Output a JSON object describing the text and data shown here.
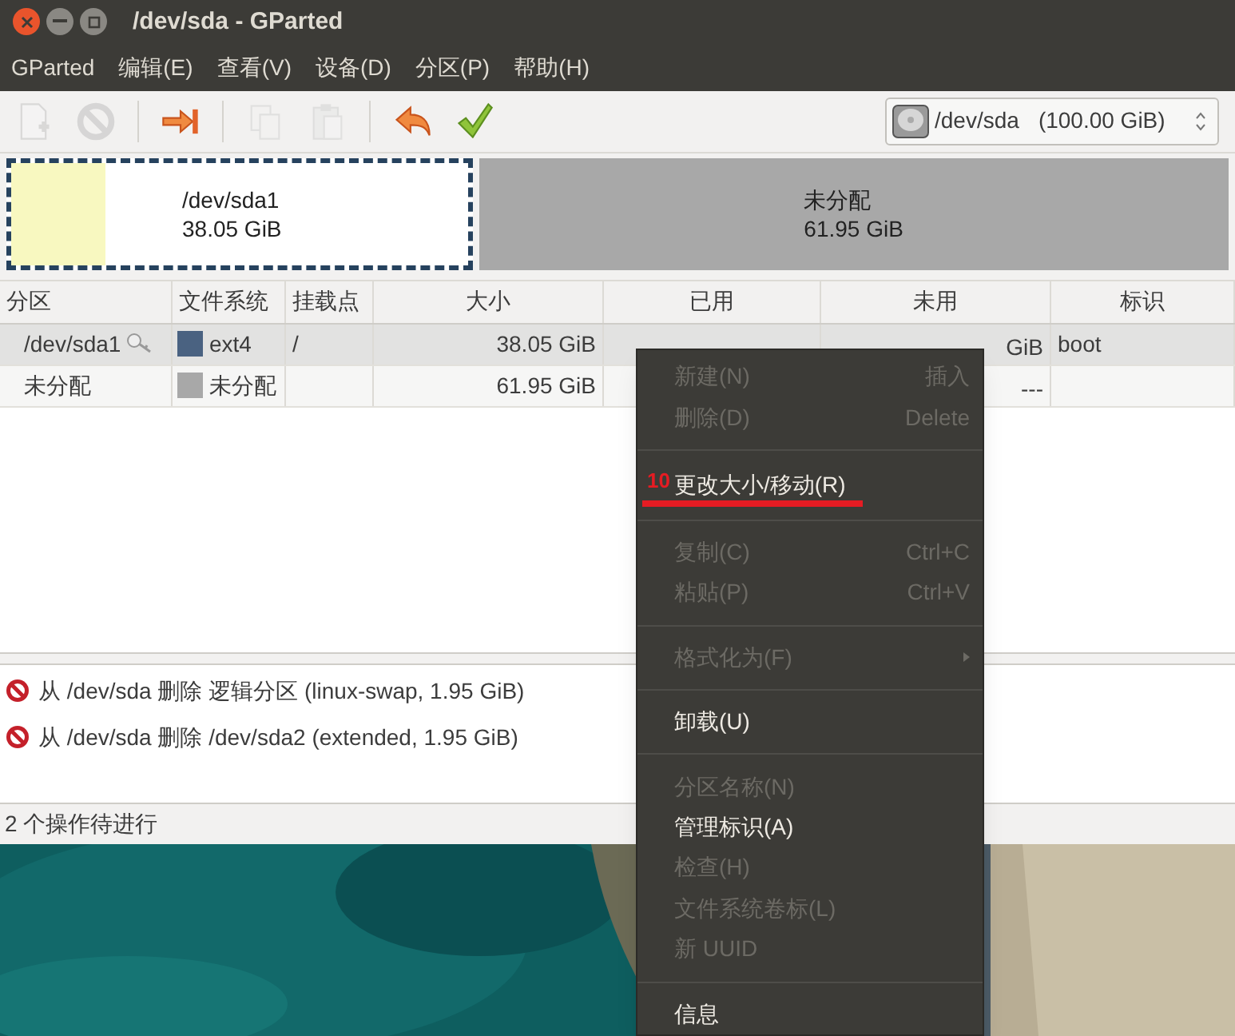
{
  "window": {
    "title": "/dev/sda - GParted"
  },
  "menubar": [
    "GParted",
    "编辑(E)",
    "查看(V)",
    "设备(D)",
    "分区(P)",
    "帮助(H)"
  ],
  "toolbar": [
    {
      "kind": "new",
      "disabled": true
    },
    {
      "kind": "delete",
      "disabled": true
    },
    {
      "kind": "separator"
    },
    {
      "kind": "resize",
      "disabled": false
    },
    {
      "kind": "separator"
    },
    {
      "kind": "copy",
      "disabled": true
    },
    {
      "kind": "paste",
      "disabled": true
    },
    {
      "kind": "separator"
    },
    {
      "kind": "undo",
      "disabled": false
    },
    {
      "kind": "apply",
      "disabled": false
    }
  ],
  "device_selector": {
    "name": "/dev/sda",
    "size": "(100.00 GiB)"
  },
  "disk_map": [
    {
      "name": "/dev/sda1",
      "size": "38.05 GiB",
      "kind": "partition",
      "selected": true
    },
    {
      "name": "未分配",
      "size": "61.95 GiB",
      "kind": "unallocated",
      "selected": false
    }
  ],
  "table": {
    "columns": [
      "分区",
      "文件系统",
      "挂载点",
      "大小",
      "已用",
      "未用",
      "标识"
    ],
    "rows": [
      {
        "partition": "/dev/sda1",
        "locked": true,
        "filesystem": "ext4",
        "color": "#4a6281",
        "mount": "/",
        "size": "38.05 GiB",
        "unused": "GiB",
        "flags": "boot",
        "selected": true
      },
      {
        "partition": "未分配",
        "locked": false,
        "filesystem": "未分配",
        "color": "#a8a8a8",
        "size": "61.95 GiB",
        "unused": "---",
        "selected": false
      }
    ]
  },
  "operations": [
    "从 /dev/sda 删除 逻辑分区 (linux-swap, 1.95 GiB)",
    "从 /dev/sda 删除 /dev/sda2 (extended, 1.95 GiB)"
  ],
  "status_bar": "2 个操作待进行",
  "context_menu": [
    {
      "kind": "item",
      "label": "新建(N)",
      "shortcut": "插入",
      "disabled": true
    },
    {
      "kind": "item",
      "label": "删除(D)",
      "shortcut": "Delete",
      "disabled": true
    },
    {
      "kind": "separator"
    },
    {
      "kind": "item",
      "label": "更改大小/移动(R)",
      "disabled": false,
      "annotation": "10"
    },
    {
      "kind": "separator"
    },
    {
      "kind": "item",
      "label": "复制(C)",
      "shortcut": "Ctrl+C",
      "disabled": true
    },
    {
      "kind": "item",
      "label": "粘贴(P)",
      "shortcut": "Ctrl+V",
      "disabled": true
    },
    {
      "kind": "separator"
    },
    {
      "kind": "item",
      "label": "格式化为(F)",
      "disabled": true,
      "submenu": true
    },
    {
      "kind": "separator"
    },
    {
      "kind": "item",
      "label": "卸载(U)",
      "disabled": false
    },
    {
      "kind": "separator"
    },
    {
      "kind": "item",
      "label": "分区名称(N)",
      "disabled": true
    },
    {
      "kind": "item",
      "label": "管理标识(A)",
      "disabled": false
    },
    {
      "kind": "item",
      "label": "检查(H)",
      "disabled": true
    },
    {
      "kind": "item",
      "label": "文件系统卷标(L)",
      "disabled": true
    },
    {
      "kind": "item",
      "label": "新 UUID",
      "disabled": true
    },
    {
      "kind": "separator"
    },
    {
      "kind": "item",
      "label": "信息",
      "disabled": false
    }
  ]
}
